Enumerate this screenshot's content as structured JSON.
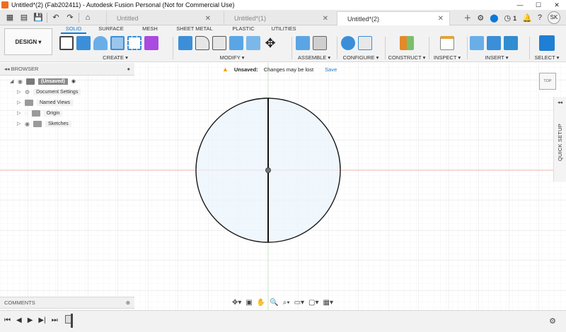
{
  "window": {
    "title": "Untitled*(2) (Fab202411) - Autodesk Fusion Personal (Not for Commercial Use)",
    "minimize": "—",
    "maximize": "☐",
    "close": "✕"
  },
  "tabs": [
    {
      "label": "Untitled",
      "close": "✕"
    },
    {
      "label": "Untitled*(1)",
      "close": "✕"
    },
    {
      "label": "Untitled*(2)",
      "close": "✕"
    }
  ],
  "tabbar": {
    "job_count": "1",
    "user_initials": "SK"
  },
  "toolbar": {
    "workspace_button": "DESIGN ▾",
    "workspace_tabs": [
      "SOLID",
      "SURFACE",
      "MESH",
      "SHEET METAL",
      "PLASTIC",
      "UTILITIES"
    ],
    "groups": [
      "CREATE ▾",
      "MODIFY ▾",
      "ASSEMBLE ▾",
      "CONFIGURE ▾",
      "CONSTRUCT ▾",
      "INSPECT ▾",
      "INSERT ▾",
      "SELECT ▾"
    ],
    "accent": "#0a7ad6"
  },
  "browser": {
    "title": "◂◂ BROWSER",
    "items": [
      {
        "label": "(Unsaved)"
      },
      {
        "label": "Document Settings"
      },
      {
        "label": "Named Views"
      },
      {
        "label": "Origin"
      },
      {
        "label": "Sketches"
      }
    ]
  },
  "notice": {
    "status": "Unsaved:",
    "message": "Changes may be lost",
    "action": "Save"
  },
  "viewcube": {
    "label": "TOP"
  },
  "quick_setup": {
    "label": "QUICK SETUP",
    "collapse": "◂◂"
  },
  "comments": {
    "title": "COMMENTS"
  }
}
